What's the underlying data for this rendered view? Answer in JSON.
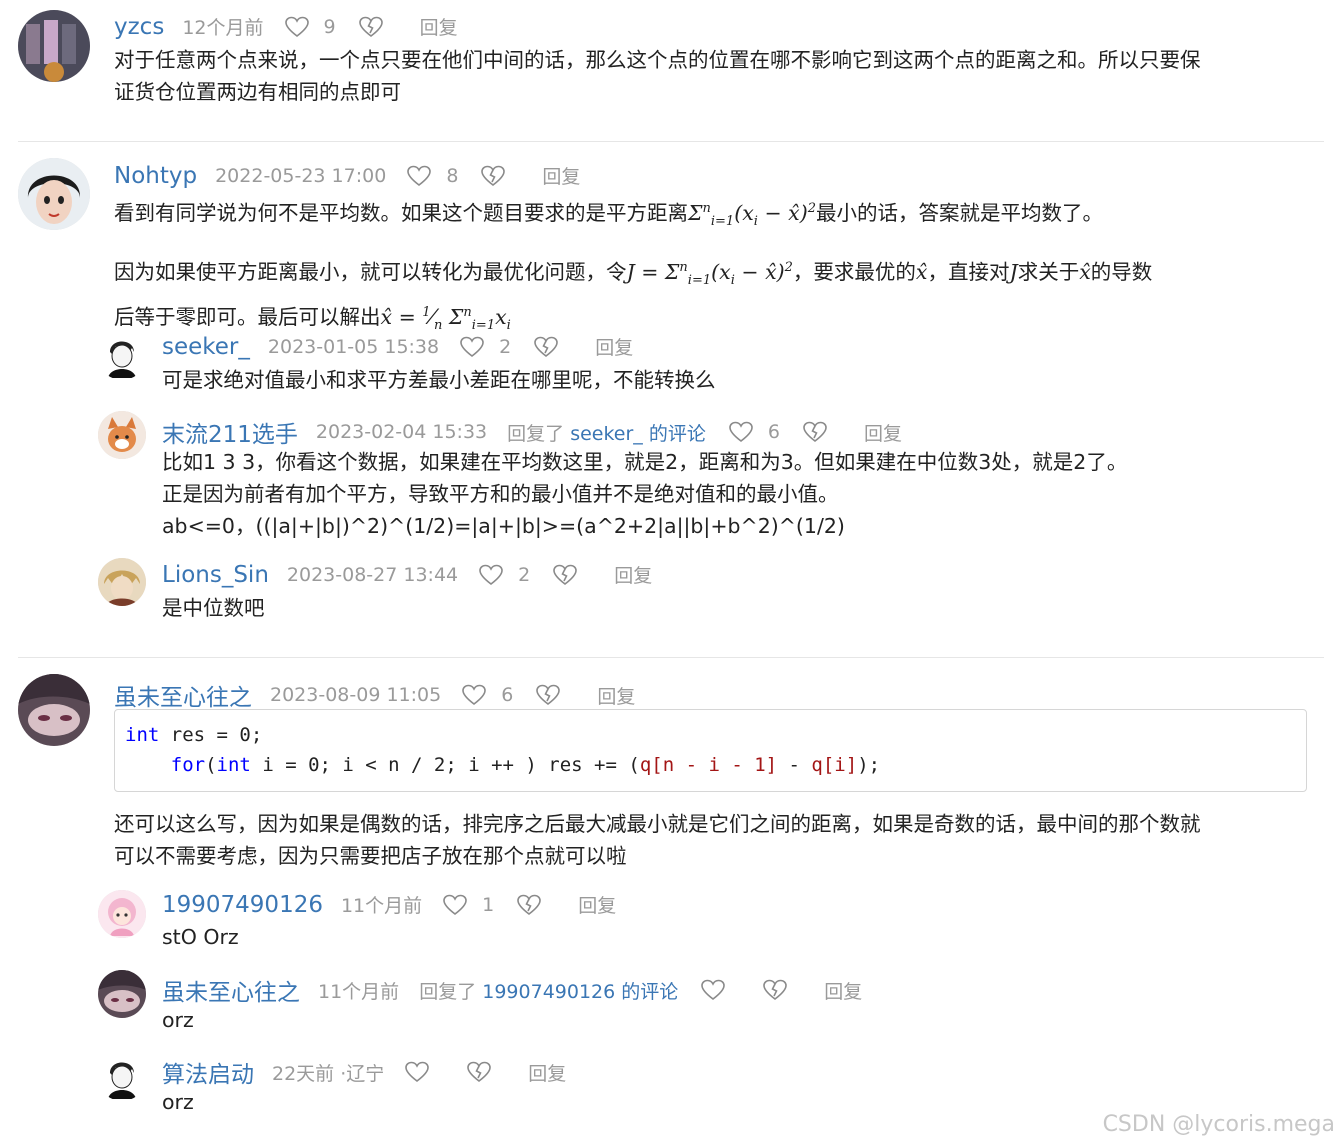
{
  "reply_label": "回复",
  "replied_prefix": "回复了",
  "comments": [
    {
      "author": "yzcs",
      "time": "12个月前",
      "likes": "9",
      "text": [
        "对于任意两个点来说，一个点只要在他们中间的话，那么这个点的位置在哪不影响它到这两个点的距离之和。所以只要保",
        "证货仓位置两边有相同的点即可"
      ]
    },
    {
      "author": "Nohtyp",
      "time": "2022-05-23 17:00",
      "likes": "8",
      "p1_a": "看到有同学说为何不是平均数。如果这个题目要求的是平方距离",
      "p1_b": "最小的话，答案就是平均数了。",
      "p2_a": "因为如果使平方距离最小，就可以转化为最优化问题，令",
      "p2_b": "，要求最优的",
      "p2_c": "，直接对",
      "p2_d": "求关于",
      "p2_e": "的导数",
      "p3_a": "后等于零即可。最后可以解出",
      "replies": [
        {
          "author": "seeker_",
          "time": "2023-01-05 15:38",
          "likes": "2",
          "text": [
            "可是求绝对值最小和求平方差最小差距在哪里呢，不能转换么"
          ]
        },
        {
          "author": "末流211选手",
          "time": "2023-02-04 15:33",
          "reply_to": "seeker_ 的评论",
          "likes": "6",
          "text": [
            "比如1 3 3，你看这个数据，如果建在平均数这里，就是2，距离和为3。但如果建在中位数3处，就是2了。",
            "正是因为前者有加个平方，导致平方和的最小值并不是绝对值和的最小值。",
            "ab<=0，((|a|+|b|)^2)^(1/2)=|a|+|b|>=(a^2+2|a||b|+b^2)^(1/2)"
          ]
        },
        {
          "author": "Lions_Sin",
          "time": "2023-08-27 13:44",
          "likes": "2",
          "text": [
            "是中位数吧"
          ]
        }
      ]
    },
    {
      "author": "虽未至心往之",
      "time": "2023-08-09 11:05",
      "likes": "6",
      "text": [
        "还可以这么写，因为如果是偶数的话，排完序之后最大减最小就是它们之间的距离，如果是奇数的话，最中间的那个数就",
        "可以不需要考虑，因为只需要把店子放在那个点就可以啦"
      ],
      "replies": [
        {
          "author": "19907490126",
          "time": "11个月前",
          "likes": "1",
          "text": [
            "stO Orz"
          ]
        },
        {
          "author": "虽未至心往之",
          "time": "11个月前",
          "reply_to": "19907490126 的评论",
          "likes": "",
          "text": [
            "orz"
          ]
        },
        {
          "author": "算法启动",
          "time": "22天前 ·辽宁",
          "likes": "",
          "text": [
            "orz"
          ]
        }
      ]
    }
  ],
  "code_lines": [
    "int res = 0;",
    "    for(int i = 0; i < n / 2; i ++ ) res += (q[n - i - 1] - q[i]);"
  ],
  "watermark": "CSDN @lycoris.mega",
  "colors": {
    "link": "#3a76b4",
    "meta": "#9a9a9a",
    "keyword": "#0000ff",
    "bracket": "#a31515"
  }
}
